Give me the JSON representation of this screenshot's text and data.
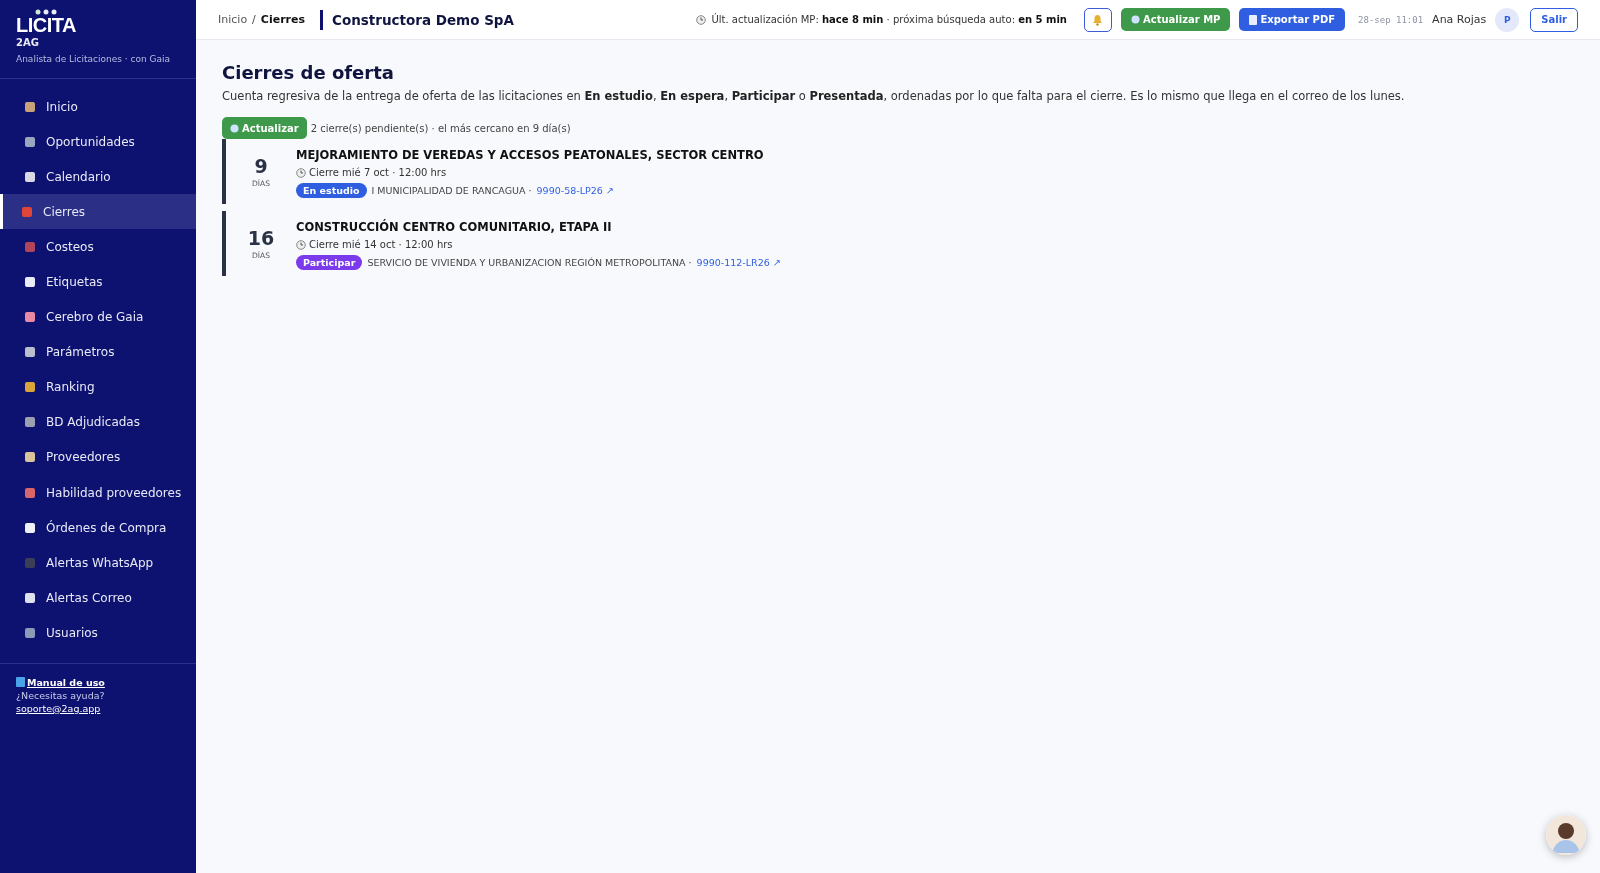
{
  "sidebar": {
    "logo": "LICITA",
    "logo_sub": "2AG",
    "tagline": "Analista de Licitaciones · con Gaia",
    "items": [
      {
        "label": "Inicio",
        "selected": false
      },
      {
        "label": "Oportunidades",
        "selected": false
      },
      {
        "label": "Calendario",
        "selected": false
      },
      {
        "label": "Cierres",
        "selected": true
      },
      {
        "label": "Costeos",
        "selected": false
      },
      {
        "label": "Etiquetas",
        "selected": false
      },
      {
        "label": "Cerebro de Gaia",
        "selected": false
      },
      {
        "label": "Parámetros",
        "selected": false
      },
      {
        "label": "Ranking",
        "selected": false
      },
      {
        "label": "BD Adjudicadas",
        "selected": false
      },
      {
        "label": "Proveedores",
        "selected": false
      },
      {
        "label": "Habilidad proveedores",
        "selected": false
      },
      {
        "label": "Órdenes de Compra",
        "selected": false
      },
      {
        "label": "Alertas WhatsApp",
        "selected": false
      },
      {
        "label": "Alertas Correo",
        "selected": false
      },
      {
        "label": "Usuarios",
        "selected": false
      }
    ],
    "footer": {
      "manual": "Manual de uso",
      "help": "¿Necesitas ayuda?",
      "email": "soporte@2ag.app"
    }
  },
  "header": {
    "breadcrumb": "Inicio",
    "breadcrumb_sep": "/",
    "breadcrumb_current": "Cierres",
    "company": "Constructora Demo SpA",
    "status": "Últ. actualización MP: **hace 8 min** · próxima búsqueda auto: **en 5 min**",
    "update_button": "Actualizar MP",
    "export_button": "Exportar PDF",
    "timestamp": "28-sep 11:01",
    "user": "Ana Rojas",
    "user_initial": "P",
    "logout": "Salir"
  },
  "page": {
    "title": "Cierres de oferta",
    "description": "Cuenta regresiva de la entrega de oferta de las licitaciones en **En estudio**, **En espera**, **Participar** o **Presentada**, ordenadas por lo que falta para el cierre. Es lo mismo que llega en el correo de los lunes.",
    "refresh_button": "Actualizar",
    "summary": "2 cierre(s) pendiente(s) · el más cercano en 9 día(s)",
    "deadlines": [
      {
        "days": "9",
        "days_label": "DÍAS",
        "title": "MEJORAMIENTO DE VEREDAS Y ACCESOS PEATONALES, SECTOR CENTRO",
        "closing": "Cierre mié 7 oct · 12:00 hrs",
        "status": "En estudio",
        "color": "#2f5fe0",
        "entity": "I MUNICIPALIDAD DE RANCAGUA ·",
        "code": "9990-58-LP26 ↗"
      },
      {
        "days": "16",
        "days_label": "DÍAS",
        "title": "CONSTRUCCIÓN CENTRO COMUNITARIO, ETAPA II",
        "closing": "Cierre mié 14 oct · 12:00 hrs",
        "status": "Participar",
        "color": "#7c3aed",
        "entity": "SERVICIO DE VIVIENDA Y URBANIZACION REGIÓN METROPOLITANA ·",
        "code": "9990-112-LR26 ↗"
      }
    ]
  }
}
